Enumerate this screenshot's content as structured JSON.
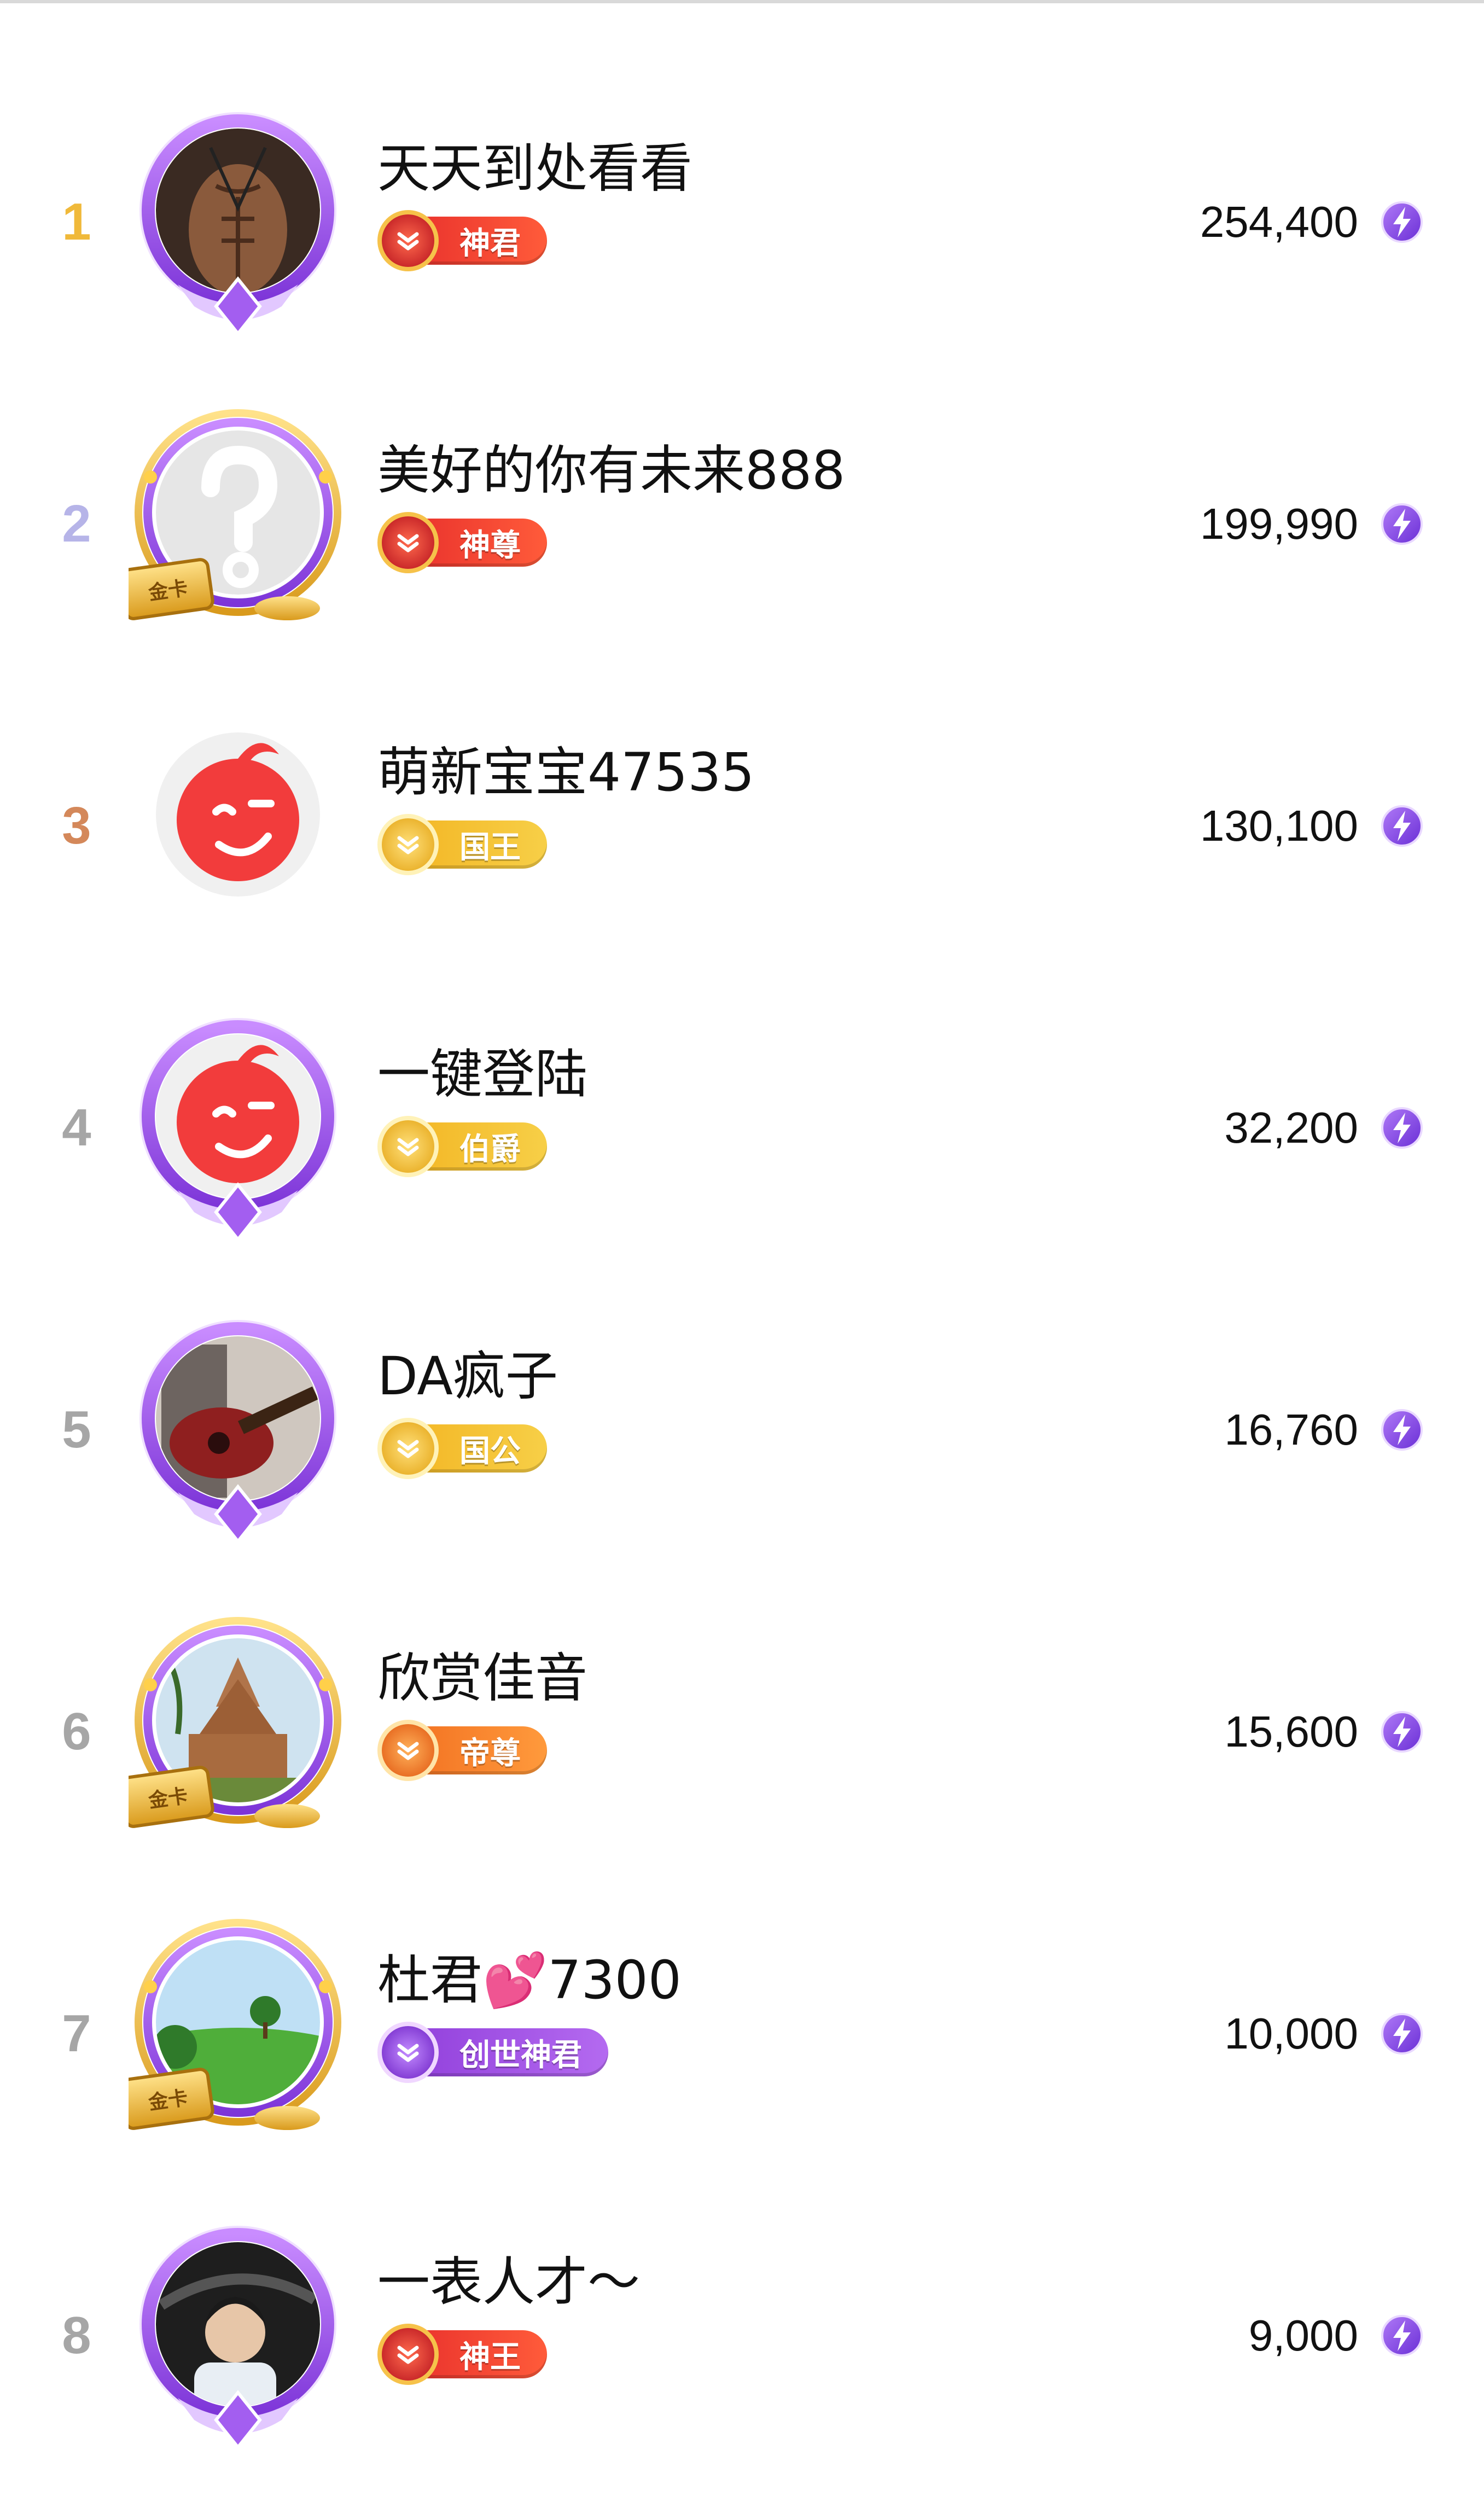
{
  "colors": {
    "rank_gold": "#f0b93a",
    "rank_silver": "#b6b4e8",
    "rank_bronze": "#d4885a",
    "rank_other": "#a6a6a6",
    "frame_purple": "#b46af0",
    "bolt_purple": "#8b42e6"
  },
  "rows": [
    {
      "rank": "1",
      "rank_color": "#f0b93a",
      "name": "天天到处看看",
      "badge_label": "神君",
      "badge_style": "red",
      "score": "254,400",
      "frame": "purple",
      "avatar_icon": "muscle-avatar-icon"
    },
    {
      "rank": "2",
      "rank_color": "#b6b4e8",
      "name": "美好的你有未来888",
      "badge_label": "神尊",
      "badge_style": "red",
      "score": "199,990",
      "frame": "gold",
      "gold_card_label": "金卡",
      "avatar_icon": "question-mark-avatar-icon"
    },
    {
      "rank": "3",
      "rank_color": "#d4885a",
      "name": "萌新宝宝47535",
      "badge_label": "国王",
      "badge_style": "gold",
      "score": "130,100",
      "frame": "none",
      "avatar_icon": "wink-face-avatar-icon"
    },
    {
      "rank": "4",
      "rank_color": "#a6a6a6",
      "name": "一键登陆",
      "badge_label": "伯爵",
      "badge_style": "gold",
      "score": "32,200",
      "frame": "purple",
      "avatar_icon": "wink-face-avatar-icon"
    },
    {
      "rank": "5",
      "rank_color": "#a6a6a6",
      "name": "DA疯子",
      "badge_label": "国公",
      "badge_style": "gold",
      "score": "16,760",
      "frame": "purple",
      "avatar_icon": "guitar-avatar-icon"
    },
    {
      "rank": "6",
      "rank_color": "#a6a6a6",
      "name": "欣赏佳音",
      "badge_label": "帝尊",
      "badge_style": "orange",
      "score": "15,600",
      "frame": "gold",
      "gold_card_label": "金卡",
      "avatar_icon": "pagoda-avatar-icon"
    },
    {
      "rank": "7",
      "rank_color": "#a6a6a6",
      "name": "杜君💕7300",
      "badge_label": "创世神君",
      "badge_style": "purple",
      "score": "10,000",
      "frame": "gold",
      "gold_card_label": "金卡",
      "avatar_icon": "meadow-tree-avatar-icon"
    },
    {
      "rank": "8",
      "rank_color": "#a6a6a6",
      "name": "一表人才～",
      "badge_label": "神王",
      "badge_style": "red",
      "score": "9,000",
      "frame": "purple",
      "avatar_icon": "man-in-car-avatar-icon"
    }
  ]
}
